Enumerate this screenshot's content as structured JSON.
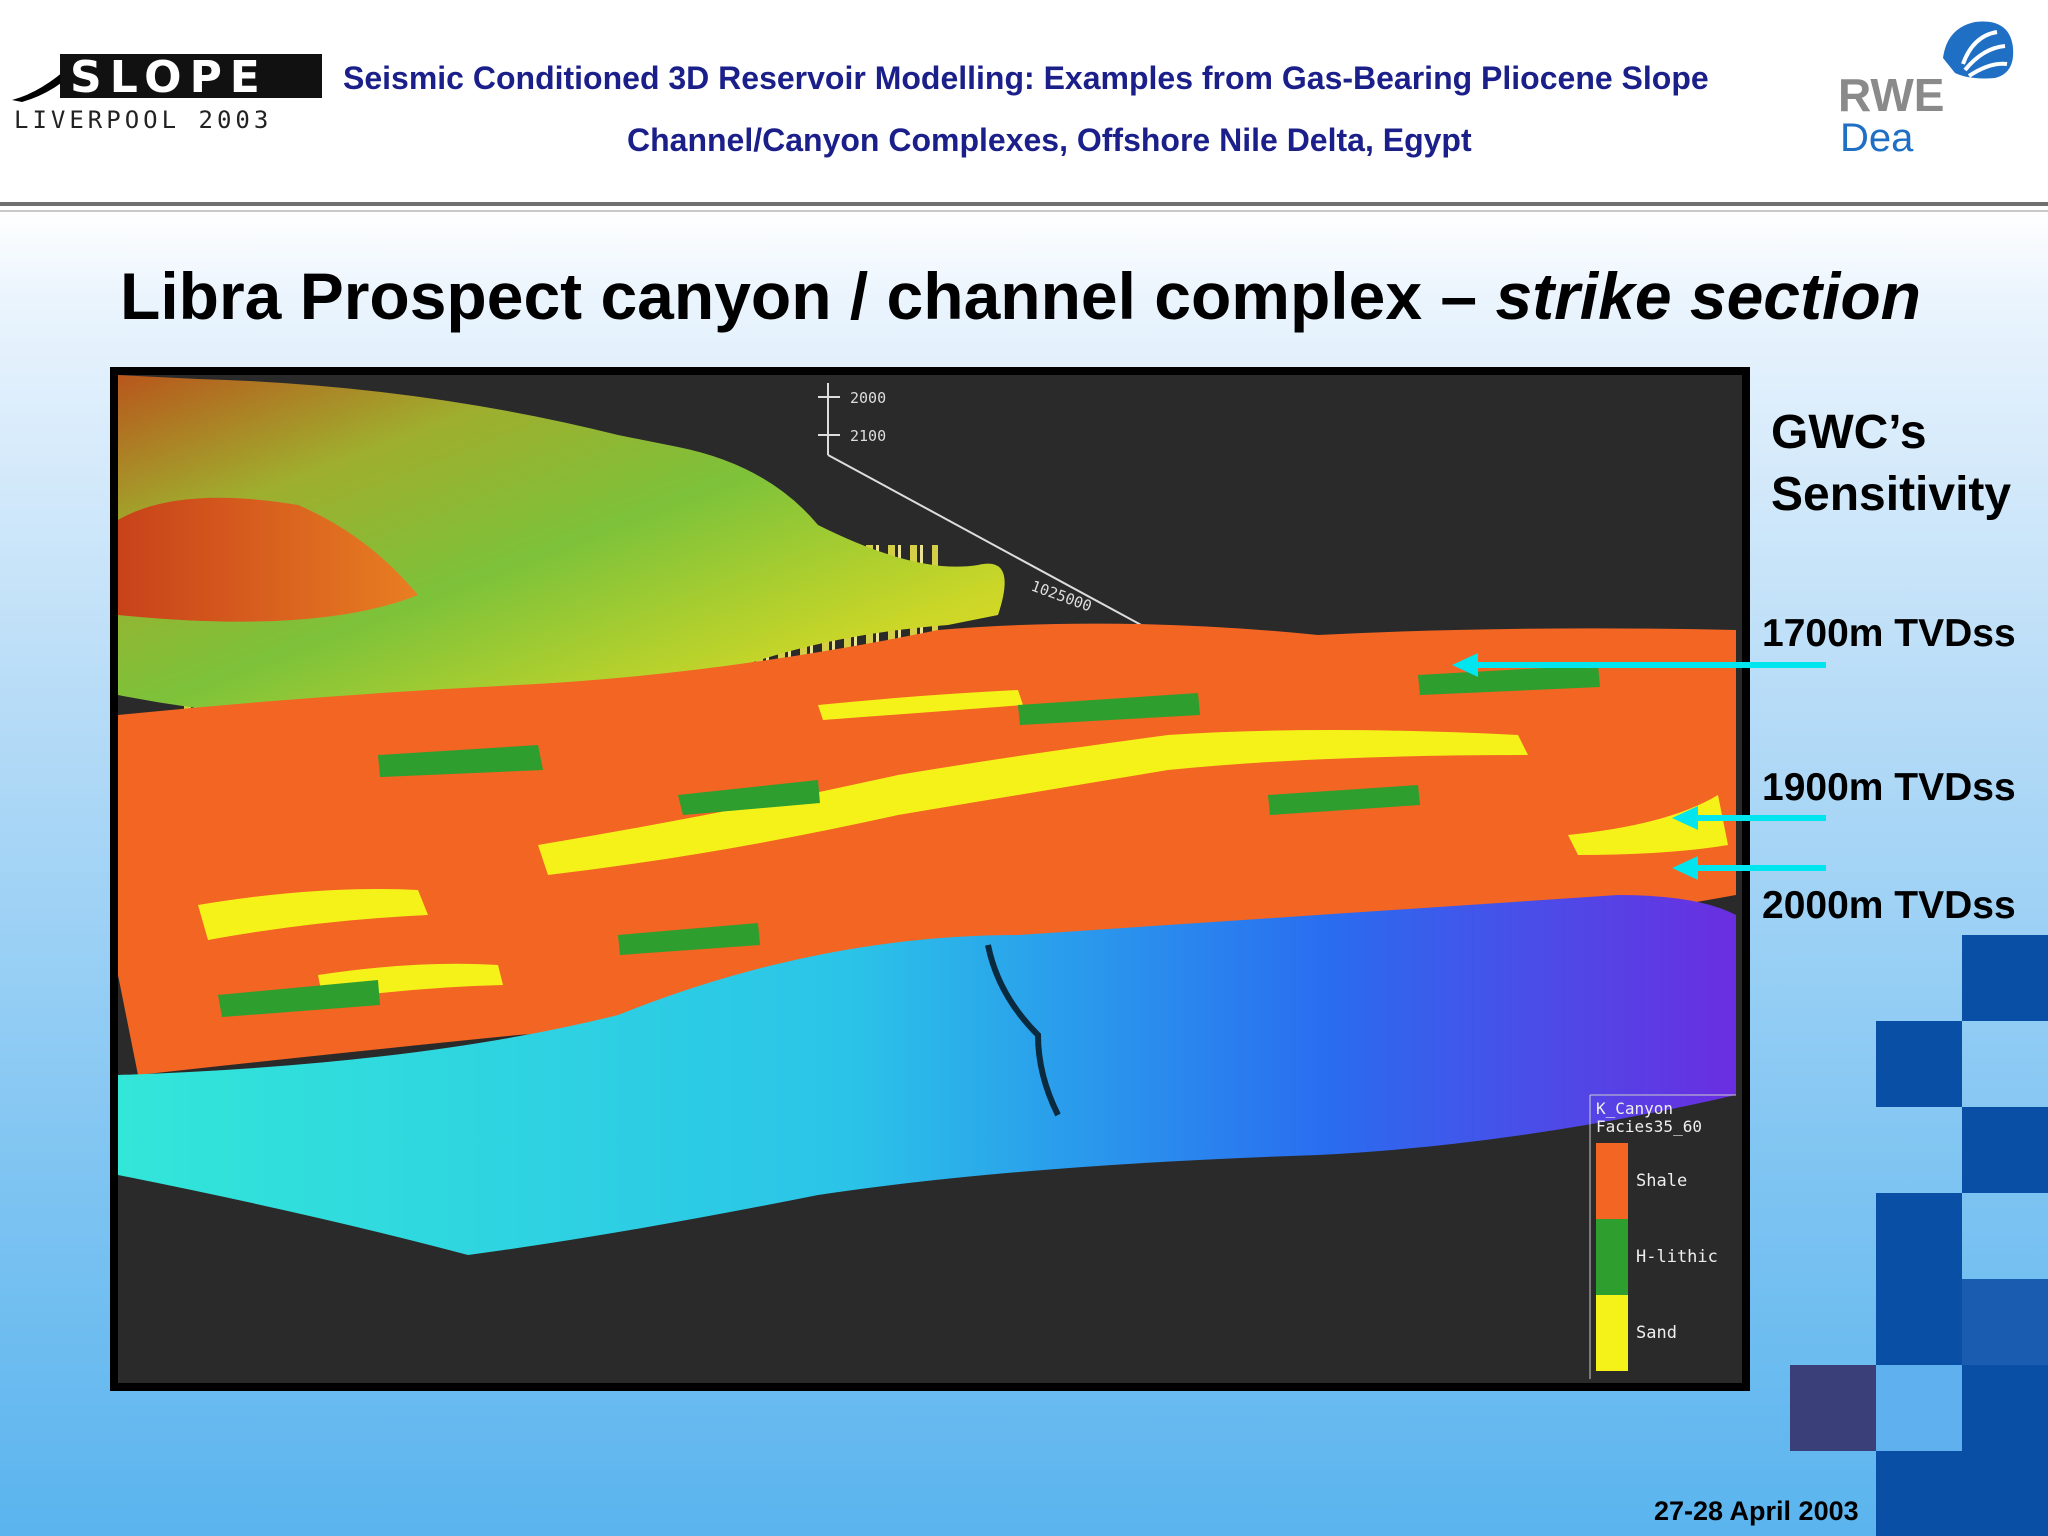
{
  "header": {
    "logo_text": "SLOPE",
    "logo_subtext": "LIVERPOOL 2003",
    "title_line1": "Seismic Conditioned 3D Reservoir Modelling:  Examples from Gas-Bearing Pliocene Slope",
    "title_line2": "Channel/Canyon Complexes, Offshore Nile Delta, Egypt",
    "brand_line1": "RWE",
    "brand_line2": "Dea"
  },
  "slide": {
    "title_main": "Libra Prospect canyon / channel complex – ",
    "title_italic": "strike section"
  },
  "panel": {
    "axis_labels": [
      "2000",
      "2100",
      "1025000"
    ],
    "legend": {
      "title_line1": "K_Canyon",
      "title_line2": "Facies35_60",
      "items": [
        {
          "label": "Shale",
          "color": "#f26522"
        },
        {
          "label": "H-lithic",
          "color": "#2e9e2e"
        },
        {
          "label": "Sand",
          "color": "#f5f21a"
        }
      ]
    }
  },
  "side": {
    "heading_line1": "GWC’s",
    "heading_line2": "Sensitivity",
    "levels": [
      "1700m TVDss",
      "1900m TVDss",
      "2000m TVDss"
    ],
    "arrow_color": "#00e5ee"
  },
  "footer": {
    "date": "27-28 April 2003"
  },
  "colors": {
    "header_text": "#1b1f8a",
    "rwe_gray": "#8a8a8a",
    "rwe_blue": "#1f6fc5",
    "deco_blue": "#0a4fa6"
  }
}
